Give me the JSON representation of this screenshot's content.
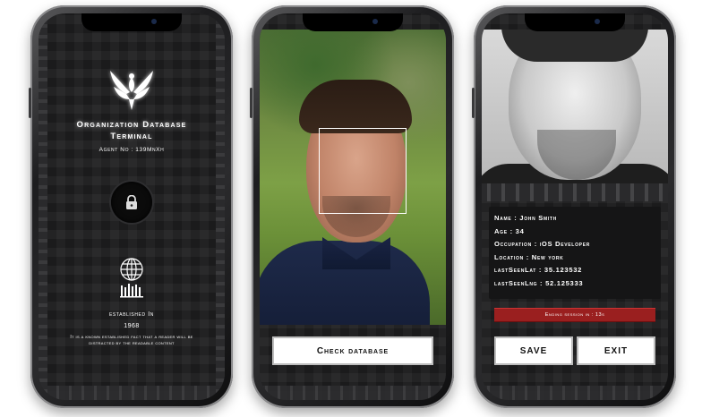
{
  "screen1": {
    "title_line1": "Organization Database",
    "title_line2": "Terminal",
    "agent": "Agent No : 139MnXh",
    "established_label": "established In",
    "year": "1968",
    "description": "It is a known established fact that a reader will be distracted by the readable content"
  },
  "screen2": {
    "check_button": "Check database"
  },
  "screen3": {
    "fields": [
      {
        "label": "Name",
        "value": "John Smith"
      },
      {
        "label": "Age",
        "value": "34"
      },
      {
        "label": "Occupation",
        "value": "iOS Developer"
      },
      {
        "label": "Location",
        "value": "New york"
      },
      {
        "label": "lastSeenLat",
        "value": "35.123532"
      },
      {
        "label": "lastSeenLng",
        "value": "52.125333"
      }
    ],
    "session_text": "Ending session in : 13s",
    "save_button": "SAVE",
    "exit_button": "EXIT"
  },
  "colors": {
    "background": "#1b1b1c",
    "session_red": "#9a1f1f",
    "text": "#ffffff"
  },
  "icons": [
    "phoenix-logo-icon",
    "lock-icon",
    "globe-icon"
  ]
}
